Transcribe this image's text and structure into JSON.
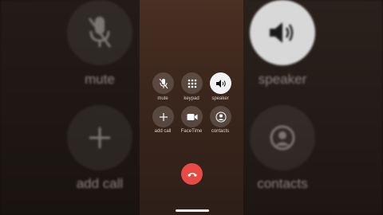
{
  "background_left": {
    "mute_label": "mute",
    "add_call_label": "add call"
  },
  "background_right": {
    "speaker_label": "speaker",
    "contacts_label": "contacts"
  },
  "call_controls": [
    {
      "label": "mute",
      "icon": "mic-off-icon",
      "active": false
    },
    {
      "label": "keypad",
      "icon": "keypad-icon",
      "active": false
    },
    {
      "label": "speaker",
      "icon": "speaker-icon",
      "active": true
    },
    {
      "label": "add call",
      "icon": "plus-icon",
      "active": false
    },
    {
      "label": "FaceTime",
      "icon": "video-camera-icon",
      "active": false
    },
    {
      "label": "contacts",
      "icon": "person-circle-icon",
      "active": false
    }
  ],
  "end_call": {
    "icon": "phone-hangup-icon",
    "color": "#e84a45"
  },
  "colors": {
    "accent_end": "#e84a45",
    "active_button": "#f2f2f2",
    "label": "#d9d3cf"
  }
}
